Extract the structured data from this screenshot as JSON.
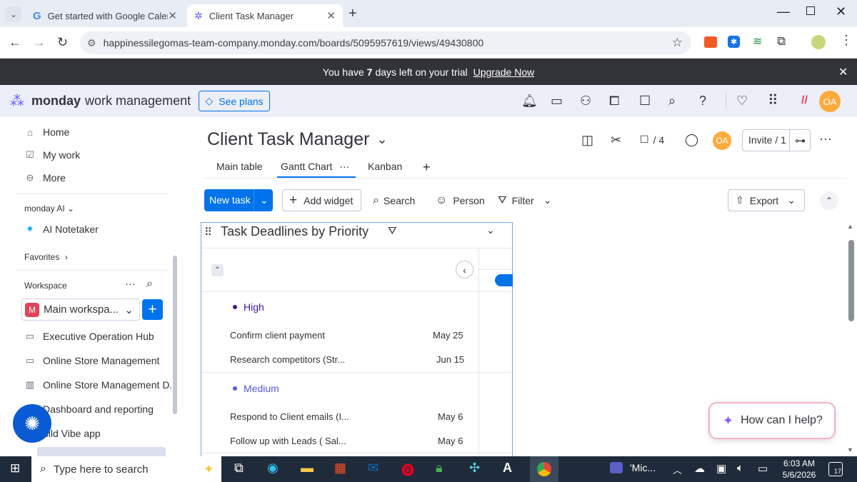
{
  "browser": {
    "tabs": [
      {
        "title": "Get started with Google Calend"
      },
      {
        "title": "Client Task Manager"
      }
    ],
    "url": "happinessilegomas-team-company.monday.com/boards/5095957619/views/49430800"
  },
  "trial_banner": {
    "prefix": "You have",
    "days": "7",
    "suffix": "days left on your trial",
    "link": "Upgrade Now"
  },
  "app": {
    "logo_bold": "monday",
    "logo_rest": "work management",
    "see_plans": "See plans",
    "avatar_initials": "OA"
  },
  "sidebar": {
    "nav": [
      {
        "label": "Home",
        "icon": "home-icon"
      },
      {
        "label": "My work",
        "icon": "calendar-check-icon"
      },
      {
        "label": "More",
        "icon": "more-circle-icon"
      }
    ],
    "monday_ai_label": "monday AI",
    "ai_notetaker": "AI Notetaker",
    "favorites": "Favorites",
    "workspace_label": "Workspace",
    "workspace_name": "Main workspa...",
    "workspace_initial": "M",
    "boards": [
      "Executive Operation Hub",
      "Online Store Management",
      "Online Store Management D...",
      "Dashboard and reporting",
      "uild Vibe app"
    ]
  },
  "board": {
    "title": "Client Task Manager",
    "automation_count": "/ 4",
    "invite": "Invite / 1",
    "views": [
      "Main table",
      "Gantt Chart",
      "Kanban"
    ],
    "toolbar": {
      "new_task": "New task",
      "add_widget": "Add widget",
      "search": "Search",
      "person": "Person",
      "filter": "Filter",
      "export": "Export"
    }
  },
  "widget": {
    "title": "Task Deadlines by Priority",
    "groups": [
      {
        "name": "High",
        "color": "#401694",
        "items": [
          {
            "name": "Confirm client payment",
            "date": "May 25"
          },
          {
            "name": "Research competitors (Str...",
            "date": "Jun 15"
          }
        ]
      },
      {
        "name": "Medium",
        "color": "#5559df",
        "items": [
          {
            "name": "Respond to Client emails (I...",
            "date": "May 6"
          },
          {
            "name": "Follow up with Leads ( Sal...",
            "date": "May 6"
          }
        ]
      }
    ]
  },
  "help_chat": "How can I help?",
  "taskbar": {
    "search_placeholder": "Type here to search",
    "app_label": "'Mic...",
    "time": "6:03 AM",
    "date": "5/6/2026",
    "notification_count": "17"
  }
}
